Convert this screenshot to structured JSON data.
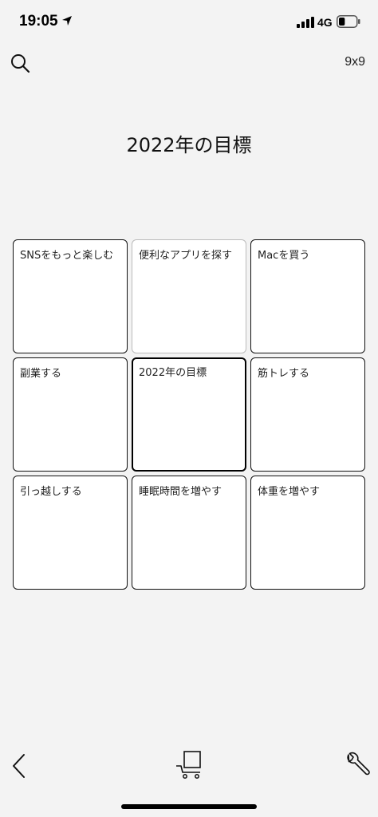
{
  "status_bar": {
    "time": "19:05",
    "network": "4G",
    "battery_level": 0.35
  },
  "header": {
    "grid_size_label": "9x9"
  },
  "title": "2022年の目標",
  "grid": {
    "cells": [
      "SNSをもっと楽しむ",
      "便利なアプリを探す",
      "Macを買う",
      "副業する",
      "2022年の目標",
      "筋トレする",
      "引っ越しする",
      "睡眠時間を増やす",
      "体重を増やす"
    ]
  },
  "icons": {
    "search": "search-icon",
    "back": "chevron-left-icon",
    "cart": "cart-icon",
    "settings": "wrench-icon"
  }
}
